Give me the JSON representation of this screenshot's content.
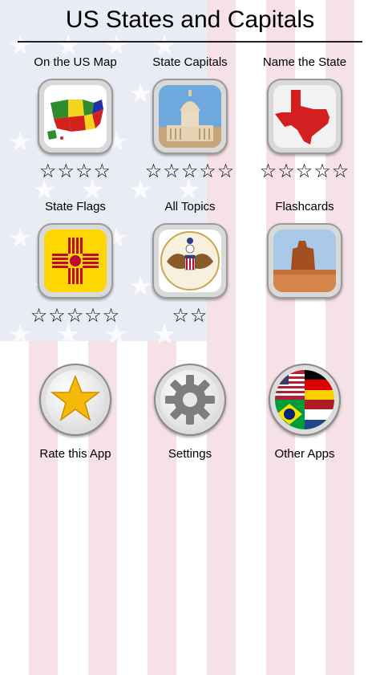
{
  "app": {
    "title": "US States and Capitals"
  },
  "topics": [
    {
      "label": "On the US Map",
      "icon": "us-map-icon",
      "stars": "☆☆☆☆"
    },
    {
      "label": "State Capitals",
      "icon": "capitol-building-icon",
      "stars": "☆☆☆☆☆"
    },
    {
      "label": "Name the State",
      "icon": "texas-shape-icon",
      "stars": "☆☆☆☆☆"
    },
    {
      "label": "State Flags",
      "icon": "new-mexico-flag-icon",
      "stars": "☆☆☆☆☆"
    },
    {
      "label": "All Topics",
      "icon": "great-seal-icon",
      "stars": "☆☆"
    },
    {
      "label": "Flashcards",
      "icon": "monument-valley-icon",
      "stars": ""
    }
  ],
  "actions": [
    {
      "label": "Rate this App",
      "icon": "star-icon"
    },
    {
      "label": "Settings",
      "icon": "gear-icon"
    },
    {
      "label": "Other Apps",
      "icon": "world-flags-icon"
    }
  ],
  "colors": {
    "stripe": "#f5e1e6",
    "canton": "#e9ecf4",
    "tile_border": "#9a9a9a"
  }
}
